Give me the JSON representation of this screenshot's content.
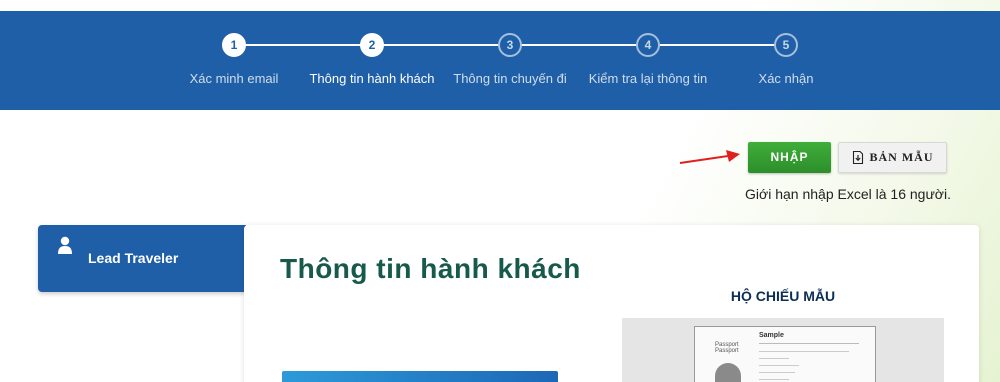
{
  "stepper": {
    "steps": [
      {
        "number": "1",
        "label": "Xác minh email",
        "status": "done"
      },
      {
        "number": "2",
        "label": "Thông tin hành khách",
        "status": "current"
      },
      {
        "number": "3",
        "label": "Thông tin chuyến đi",
        "status": "todo"
      },
      {
        "number": "4",
        "label": "Kiểm tra lại thông tin",
        "status": "todo"
      },
      {
        "number": "5",
        "label": "Xác nhận",
        "status": "todo"
      }
    ],
    "band_color": "#1f5fa8"
  },
  "actions": {
    "import_label": "NHẬP",
    "template_label": "BẢN MẪU",
    "excel_note": "Giới hạn nhập Excel là 16 người.",
    "import_color": "#34a032"
  },
  "sidebar": {
    "lead_label": "Lead Traveler"
  },
  "main": {
    "title": "Thông tin hành khách",
    "passport_heading": "HỘ CHIẾU MẪU",
    "passport_sample": {
      "sample_word": "Sample",
      "line1": "Passport",
      "line2": "Passport"
    }
  },
  "colors": {
    "title": "#17594a",
    "accent": "#1f5fa8"
  }
}
